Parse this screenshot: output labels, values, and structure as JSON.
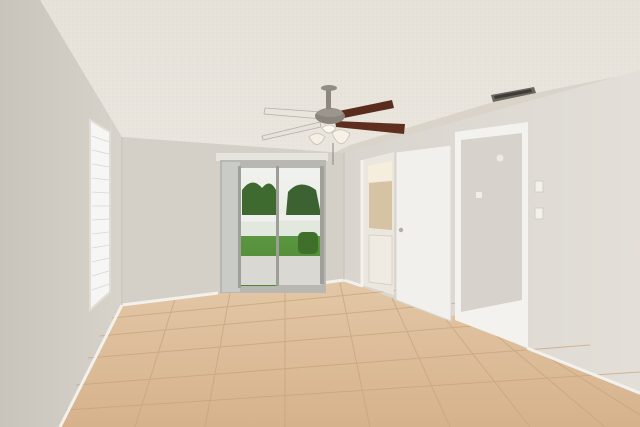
{
  "scene": {
    "kind": "photo",
    "subject": "empty-room",
    "colors": {
      "ceiling": "#e9e5dd",
      "wall_left": "#d6d1c9",
      "wall_back": "#d2cdc5",
      "wall_right": "#dedad3",
      "floor": "#d9b996",
      "grout": "#c9a882",
      "baseboard": "#f4f2ee",
      "door": "#f1efeb",
      "fan_blade": "#5e2e1f",
      "metal": "#8a8580",
      "lawn": "#4f8a3a",
      "trees": "#3f6a2f",
      "sky": "#eef0ea"
    }
  }
}
